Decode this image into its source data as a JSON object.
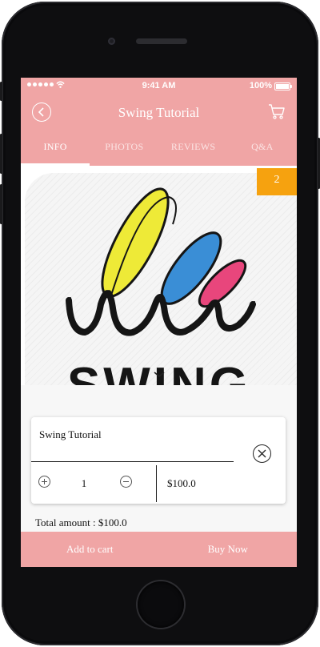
{
  "status_bar": {
    "time": "9:41 AM",
    "battery": "100%"
  },
  "header": {
    "title": "Swing Tutorial"
  },
  "tabs": [
    {
      "label": "INFO",
      "active": true
    },
    {
      "label": "PHOTOS",
      "active": false
    },
    {
      "label": "REVIEWS",
      "active": false
    },
    {
      "label": "Q&A",
      "active": false
    }
  ],
  "hero": {
    "badge": "2",
    "logo_text": "SWING"
  },
  "cart_item": {
    "title": "Swing Tutorial",
    "quantity": "1",
    "price": "$100.0"
  },
  "summary": {
    "total": "Total amount : $100.0"
  },
  "actions": {
    "add_to_cart": "Add to cart",
    "buy_now": "Buy Now"
  },
  "colors": {
    "accent": "#f0a5a5",
    "badge": "#f6a20f",
    "logo_yellow": "#eeea37",
    "logo_blue": "#3a8ed6",
    "logo_pink": "#e8467c"
  },
  "icons": [
    "back-arrow-icon",
    "cart-icon",
    "plus-icon",
    "minus-icon",
    "close-circle-icon",
    "chevron-down-icon",
    "wifi-icon",
    "battery-icon"
  ]
}
